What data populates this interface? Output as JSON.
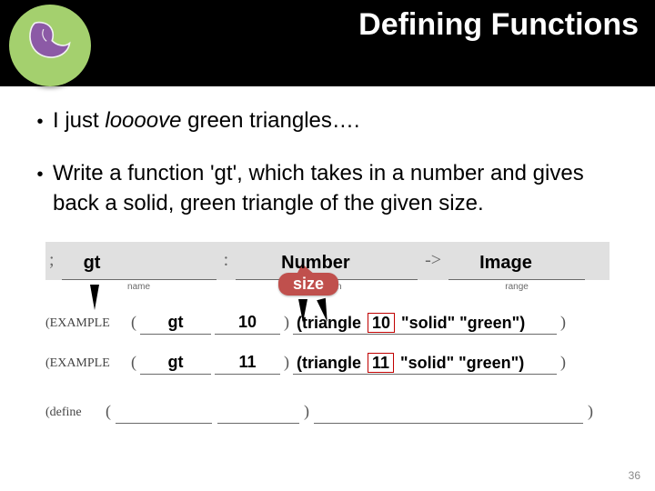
{
  "header": {
    "title": "Defining Functions"
  },
  "bullets": {
    "b1_pre": "I just ",
    "b1_em": "loooove",
    "b1_post": " green triangles….",
    "b2": "Write a function 'gt', which takes in a number and gives back a solid, green triangle of the given size."
  },
  "contract": {
    "semi": ";",
    "colon": ":",
    "arrow": "->",
    "name": "gt",
    "domain": "Number",
    "range": "Image",
    "sub_name": "name",
    "sub_domain": "domain",
    "sub_range": "range",
    "callout_size": "size"
  },
  "examples": {
    "label": "(EXAMPLE",
    "paren_open": "(",
    "paren_close": ")",
    "rows": [
      {
        "name": "gt",
        "arg": "10",
        "body_pre": "(triangle ",
        "body_box": "10",
        "body_post": "  \"solid\" \"green\")"
      },
      {
        "name": "gt",
        "arg": "11",
        "body_pre": "(triangle ",
        "body_box": "11",
        "body_post": "  \"solid\" \"green\")"
      }
    ]
  },
  "define": {
    "label": "(define",
    "paren_open": "(",
    "paren_close": ")"
  },
  "pagenum": "36"
}
